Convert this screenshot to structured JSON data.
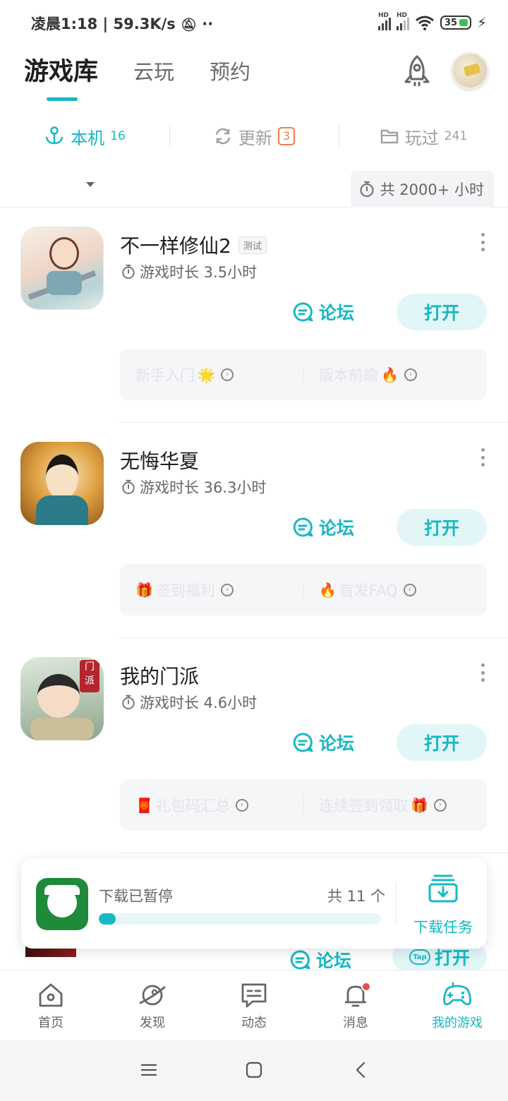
{
  "status_bar": {
    "time_speed": "凌晨1:18 | 59.3K/s",
    "battery": "35"
  },
  "top_tabs": [
    {
      "label": "游戏库",
      "active": true
    },
    {
      "label": "云玩",
      "active": false
    },
    {
      "label": "预约",
      "active": false
    }
  ],
  "sub_tabs": {
    "local": {
      "label": "本机",
      "count": "16"
    },
    "update": {
      "label": "更新",
      "count": "3"
    },
    "played": {
      "label": "玩过",
      "count": "241"
    }
  },
  "total_time": "共 2000+ 小时",
  "games": [
    {
      "name": "不一样修仙2",
      "tag": "测试",
      "playtime": "游戏时长 3.5小时",
      "forum": "论坛",
      "open": "打开",
      "tips": [
        {
          "emoji_before": "",
          "text": "新手入门",
          "emoji_after": "🌟"
        },
        {
          "emoji_before": "",
          "text": "版本前瞻",
          "emoji_after": "🔥"
        }
      ]
    },
    {
      "name": "无悔华夏",
      "tag": "",
      "playtime": "游戏时长 36.3小时",
      "forum": "论坛",
      "open": "打开",
      "tips": [
        {
          "emoji_before": "🎁",
          "text": "签到福利",
          "emoji_after": ""
        },
        {
          "emoji_before": "🔥",
          "text": "首发FAQ",
          "emoji_after": ""
        }
      ]
    },
    {
      "name": "我的门派",
      "tag": "",
      "playtime": "游戏时长 4.6小时",
      "forum": "论坛",
      "open": "打开",
      "tips": [
        {
          "emoji_before": "🧧",
          "text": "礼包码汇总",
          "emoji_after": ""
        },
        {
          "emoji_before": "",
          "text": "连续签到领取",
          "emoji_after": "🎁"
        }
      ]
    }
  ],
  "partial_item": {
    "forum": "论坛",
    "open": "打开",
    "tap_logo": "Tap"
  },
  "download": {
    "status": "下载已暂停",
    "count": "共 11 个",
    "progress": 0.06,
    "task_label": "下载任务"
  },
  "bottom_nav": [
    {
      "label": "首页",
      "icon": "home-icon",
      "active": false
    },
    {
      "label": "发现",
      "icon": "planet-icon",
      "active": false
    },
    {
      "label": "动态",
      "icon": "chat-icon",
      "active": false
    },
    {
      "label": "消息",
      "icon": "bell-icon",
      "active": false,
      "dot": true
    },
    {
      "label": "我的游戏",
      "icon": "gamepad-icon",
      "active": true
    }
  ],
  "colors": {
    "accent": "#16b8c4",
    "badge": "#f07d4a",
    "notify": "#f04b4b"
  }
}
